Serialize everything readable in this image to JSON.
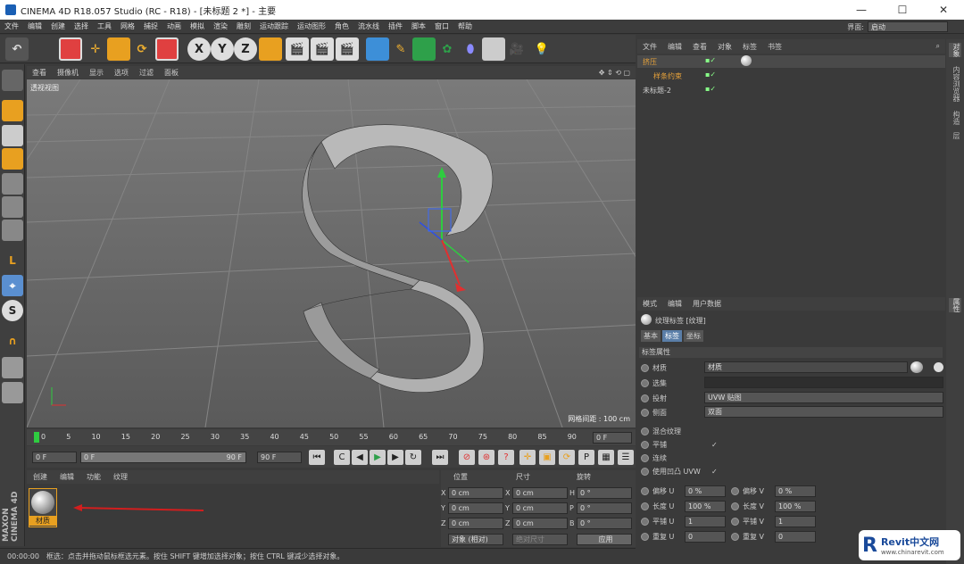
{
  "title_bar": {
    "text": "CINEMA 4D R18.057 Studio (RC - R18) - [未标题 2 *] - 主要",
    "minimize": "—",
    "maximize": "☐",
    "close": "✕"
  },
  "menu": [
    "文件",
    "编辑",
    "创建",
    "选择",
    "工具",
    "网格",
    "捕捉",
    "动画",
    "模拟",
    "渲染",
    "雕刻",
    "运动跟踪",
    "运动图形",
    "角色",
    "流水线",
    "插件",
    "脚本",
    "窗口",
    "帮助"
  ],
  "layout": {
    "label": "界面:",
    "value": "启动"
  },
  "toolbar": {
    "undo": "↶",
    "x": "X",
    "y": "Y",
    "z": "Z"
  },
  "viewport": {
    "menu": [
      "查看",
      "摄像机",
      "显示",
      "选项",
      "过滤",
      "面板"
    ],
    "label": "透视视图",
    "grid_info": "网格间距 : 100 cm",
    "nav": "✥ ⇕ ⟲ ▢"
  },
  "timeline": {
    "ticks": [
      "0",
      "5",
      "10",
      "15",
      "20",
      "25",
      "30",
      "35",
      "40",
      "45",
      "50",
      "55",
      "60",
      "65",
      "70",
      "75",
      "80",
      "85",
      "90"
    ],
    "end_field": "0 F"
  },
  "transport": {
    "start": "0 F",
    "range_start": "0 F",
    "range_end": "90 F",
    "end": "90 F"
  },
  "materials": {
    "menu": [
      "创建",
      "编辑",
      "功能",
      "纹理"
    ],
    "item_label": "材质"
  },
  "coordinates": {
    "headers": [
      "位置",
      "尺寸",
      "旋转"
    ],
    "rows": [
      {
        "axis": "X",
        "pos": "0 cm",
        "saxis": "X",
        "size": "0 cm",
        "raxis": "H",
        "rot": "0 °"
      },
      {
        "axis": "Y",
        "pos": "0 cm",
        "saxis": "Y",
        "size": "0 cm",
        "raxis": "P",
        "rot": "0 °"
      },
      {
        "axis": "Z",
        "pos": "0 cm",
        "saxis": "Z",
        "size": "0 cm",
        "raxis": "B",
        "rot": "0 °"
      }
    ],
    "mode": "对象 (相对)",
    "size_mode": "绝对尺寸",
    "apply": "应用"
  },
  "status": {
    "time": "00:00:00",
    "message": "框选：点击并拖动鼠标框选元素。按住 SHIFT 键增加选择对象；按住 CTRL 键减少选择对象。"
  },
  "branding": {
    "maxon": "MAXON",
    "c4d": "CINEMA 4D"
  },
  "objects": {
    "menu": [
      "文件",
      "编辑",
      "查看",
      "对象",
      "标签",
      "书签"
    ],
    "items": [
      {
        "name": "挤压",
        "color": "#e8a33a"
      },
      {
        "name": "样条约束",
        "color": "#e8a33a"
      },
      {
        "name": "未标题-2",
        "color": "#cfcfcf"
      }
    ]
  },
  "attributes": {
    "menu": [
      "模式",
      "编辑",
      "用户数据"
    ],
    "title": "纹理标签 [纹理]",
    "tabs": [
      "基本",
      "标签",
      "坐标"
    ],
    "section": "标签属性",
    "rows": [
      {
        "label": "材质",
        "value": "材质"
      },
      {
        "label": "选集",
        "value": ""
      },
      {
        "label": "投射",
        "value": "UVW 贴图"
      },
      {
        "label": "侧面",
        "value": "双面"
      }
    ],
    "checks": [
      {
        "label": "混合纹理",
        "checked": ""
      },
      {
        "label": "平铺",
        "checked": "✓"
      },
      {
        "label": "连续",
        "checked": ""
      },
      {
        "label": "使用凹凸 UVW",
        "checked": "✓"
      }
    ],
    "uv": [
      {
        "l1": "偏移 U",
        "v1": "0 %",
        "l2": "偏移 V",
        "v2": "0 %"
      },
      {
        "l1": "长度 U",
        "v1": "100 %",
        "l2": "长度 V",
        "v2": "100 %"
      },
      {
        "l1": "平铺 U",
        "v1": "1",
        "l2": "平铺 V",
        "v2": "1"
      },
      {
        "l1": "重复 U",
        "v1": "0",
        "l2": "重复 V",
        "v2": "0"
      }
    ]
  },
  "right_tabs": [
    "对象",
    "内容浏览器",
    "构造",
    "层"
  ],
  "right_tabs2": [
    "属性"
  ],
  "watermark": {
    "brand": "Revit中文网",
    "url": "www.chinarevit.com"
  }
}
